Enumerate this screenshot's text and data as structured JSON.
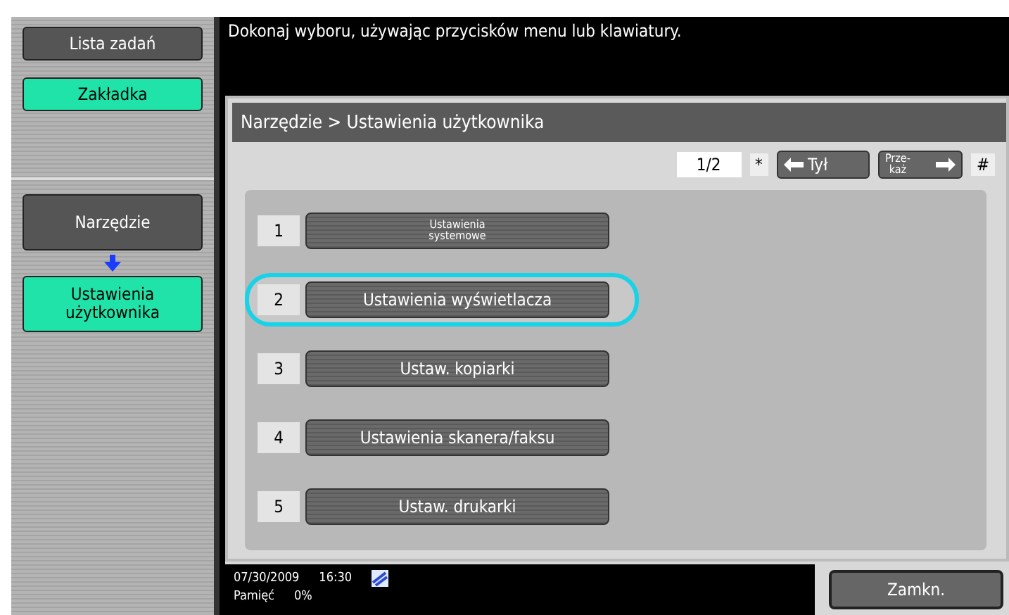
{
  "sidebar": {
    "items": [
      {
        "label": "Lista zadań",
        "selected": false
      },
      {
        "label": "Zakładka",
        "selected": true
      }
    ],
    "path": [
      {
        "label": "Narzędzie",
        "kind": "dark"
      },
      {
        "label": "Ustawienia\nużytkownika",
        "kind": "green"
      }
    ]
  },
  "message": "Dokonaj wyboru, używając przycisków menu lub klawiatury.",
  "breadcrumb": "Narzędzie > Ustawienia użytkownika",
  "pager": {
    "page": "1/2",
    "star": "*",
    "back": "Tył",
    "hash": "#",
    "forward": "Prze-\nkaż"
  },
  "menu": [
    {
      "number": "1",
      "label": "Ustawienia\nsystemowe",
      "small": true,
      "selected": false
    },
    {
      "number": "2",
      "label": "Ustawienia wyświetlacza",
      "small": false,
      "selected": true
    },
    {
      "number": "3",
      "label": "Ustaw. kopiarki",
      "small": false,
      "selected": false
    },
    {
      "number": "4",
      "label": "Ustawienia skanera/faksu",
      "small": false,
      "selected": false
    },
    {
      "number": "5",
      "label": "Ustaw. drukarki",
      "small": false,
      "selected": false
    }
  ],
  "status_bar": {
    "date": "07/30/2009",
    "time": "16:30",
    "memory_label": "Pamięć",
    "memory": "0%"
  },
  "close_button": "Zamkn."
}
